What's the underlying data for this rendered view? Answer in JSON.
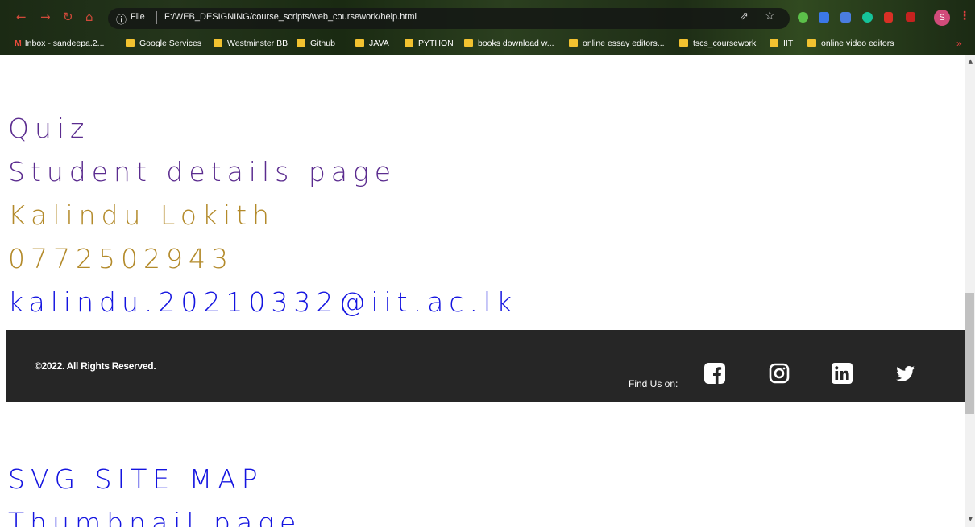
{
  "browser": {
    "omnibox": {
      "scheme_label": "File",
      "url": "F:/WEB_DESIGNING/course_scripts/web_coursework/help.html"
    },
    "profile_initial": "S",
    "bookmarks": [
      {
        "label": "Inbox - sandeepa.2...",
        "icon": "gmail-icon"
      },
      {
        "label": "Google Services",
        "icon": "folder-icon"
      },
      {
        "label": "Westminster BB",
        "icon": "folder-icon"
      },
      {
        "label": "Github",
        "icon": "folder-icon"
      },
      {
        "label": "JAVA",
        "icon": "folder-icon"
      },
      {
        "label": "PYTHON",
        "icon": "folder-icon"
      },
      {
        "label": "books download w...",
        "icon": "folder-icon"
      },
      {
        "label": "online essay editors...",
        "icon": "folder-icon"
      },
      {
        "label": "tscs_coursework",
        "icon": "folder-icon"
      },
      {
        "label": "IIT",
        "icon": "folder-icon"
      },
      {
        "label": "online video editors",
        "icon": "folder-icon"
      }
    ],
    "bookmarks_more": "»"
  },
  "page": {
    "lines": [
      {
        "text": "Quiz",
        "color": "#5b2c8f"
      },
      {
        "text": "Student details page",
        "color": "#5b2c8f"
      },
      {
        "text": "Kalindu Lokith",
        "color": "#b38a2a"
      },
      {
        "text": "0772502943",
        "color": "#b38a2a"
      },
      {
        "text": "kalindu.20210332@iit.ac.lk",
        "color": "#1414e0"
      }
    ],
    "footer": {
      "copyright": "©2022. All Rights Reserved.",
      "find_us": "Find Us on:",
      "social_icons": [
        "facebook-icon",
        "instagram-icon",
        "linkedin-icon",
        "twitter-icon"
      ]
    },
    "links_below": [
      {
        "text": "SVG SITE MAP",
        "color": "#1414e0"
      },
      {
        "text": "Thumbnail page",
        "color": "#1414e0"
      }
    ]
  }
}
